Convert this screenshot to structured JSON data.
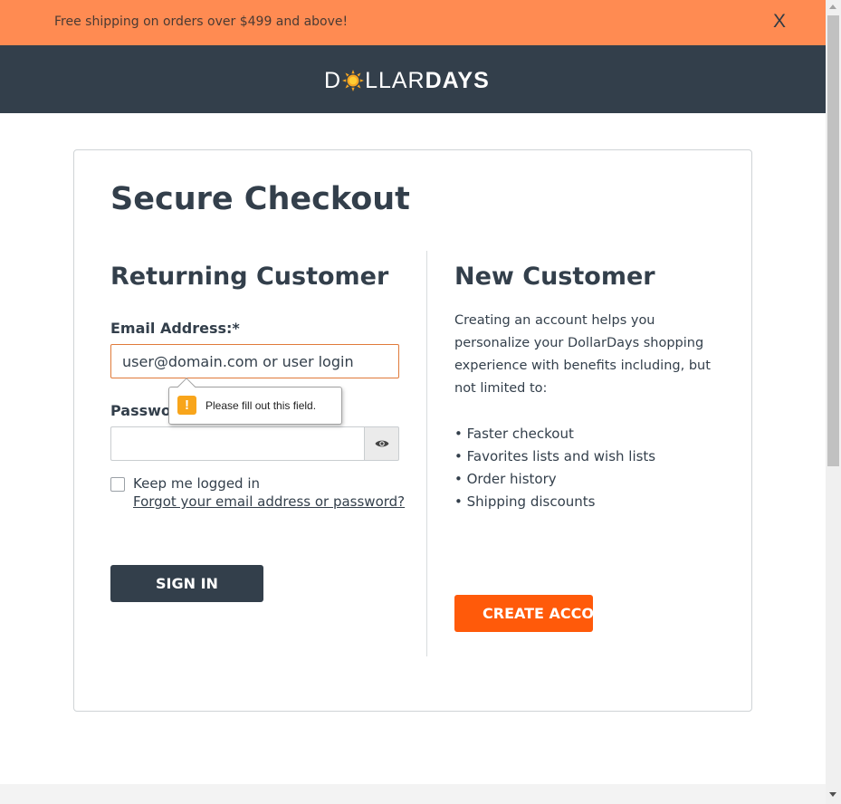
{
  "promo": {
    "text": "Free shipping on orders over $499 and above!",
    "close_label": "X"
  },
  "header": {
    "logo_prefix": "D",
    "logo_light": "LLAR",
    "logo_bold": "DAYS",
    "logo_icon": "sun-icon"
  },
  "checkout": {
    "title": "Secure Checkout"
  },
  "returning": {
    "title": "Returning Customer",
    "email_label": "Email Address:*",
    "email_placeholder": "user@domain.com or user login",
    "password_label": "Password:*",
    "password_value": "",
    "show_password_icon": "eye-icon",
    "validation_message": "Please fill out this field.",
    "validation_icon": "!",
    "keep_logged_in_label": "Keep me logged in",
    "keep_logged_in_checked": false,
    "forgot_link": "Forgot your email address or password?",
    "sign_in_label": "SIGN IN"
  },
  "new_customer": {
    "title": "New Customer",
    "description": "Creating an account helps you personalize your DollarDays shopping experience with benefits including, but not limited to:",
    "benefits": [
      "Faster checkout",
      "Favorites lists and wish lists",
      "Order history",
      "Shipping discounts"
    ],
    "create_label": "CREATE ACCOUNT"
  },
  "colors": {
    "promo_bg": "#ff8b52",
    "header_bg": "#333f4b",
    "primary_button": "#333f4b",
    "accent_button": "#ff5a0a",
    "warning": "#f8a51b"
  }
}
